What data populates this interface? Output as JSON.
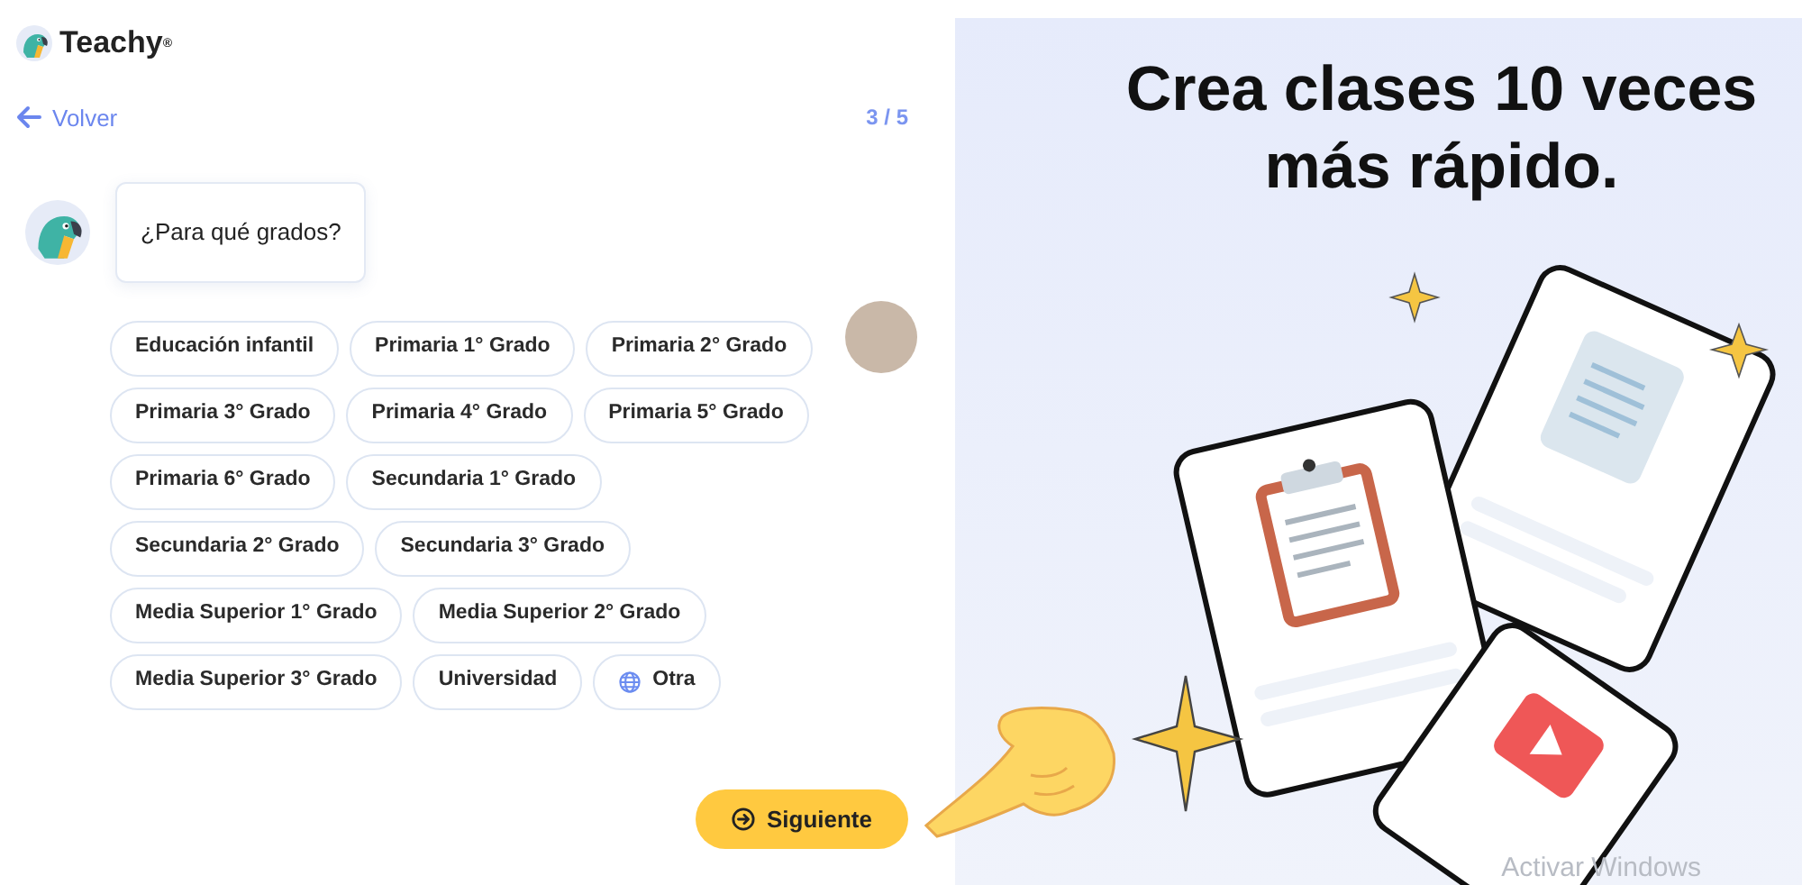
{
  "brand": {
    "name": "Teachy",
    "mark": "®"
  },
  "nav": {
    "back": "Volver",
    "step": "3 / 5"
  },
  "question": "¿Para qué grados?",
  "grade_rows": [
    [
      {
        "label": "Educación infantil",
        "kind": "grade"
      },
      {
        "label": "Primaria 1° Grado",
        "kind": "grade"
      },
      {
        "label": "Primaria 2° Grado",
        "kind": "grade"
      }
    ],
    [
      {
        "label": "Primaria 3° Grado",
        "kind": "grade"
      },
      {
        "label": "Primaria 4° Grado",
        "kind": "grade"
      },
      {
        "label": "Primaria 5° Grado",
        "kind": "grade"
      }
    ],
    [
      {
        "label": "Primaria 6° Grado",
        "kind": "grade"
      },
      {
        "label": "Secundaria 1° Grado",
        "kind": "grade"
      }
    ],
    [
      {
        "label": "Secundaria 2° Grado",
        "kind": "grade"
      },
      {
        "label": "Secundaria 3° Grado",
        "kind": "grade"
      }
    ],
    [
      {
        "label": "Media Superior 1° Grado",
        "kind": "grade"
      },
      {
        "label": "Media Superior 2° Grado",
        "kind": "grade"
      }
    ],
    [
      {
        "label": "Media Superior 3° Grado",
        "kind": "grade"
      },
      {
        "label": "Universidad",
        "kind": "grade"
      },
      {
        "label": "Otra",
        "kind": "other"
      }
    ]
  ],
  "next_button": "Siguiente",
  "promo": {
    "title": "Crea clases 10 veces más rápido."
  },
  "os_notice": "Activar Windows"
}
